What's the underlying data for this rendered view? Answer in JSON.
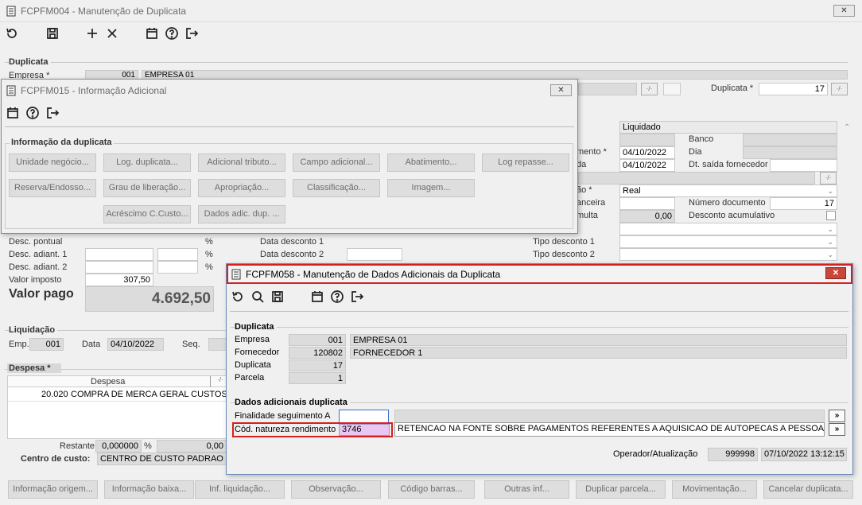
{
  "main": {
    "title": "FCPFM004 - Manutenção de Duplicata",
    "sections": {
      "duplicata": "Duplicata",
      "liquidacao": "Liquidação",
      "despesa": "Despesa *"
    },
    "labels": {
      "empresa": "Empresa *",
      "duplicata": "Duplicata *",
      "liquidado": "Liquidado",
      "banco": "Banco",
      "dia": "Dia",
      "dt_saida": "Dt. saída fornecedor",
      "mento": "mento *",
      "da": "da",
      "ao": "ão *",
      "anceira": "anceira",
      "numero_documento": "Número documento",
      "multa": "multa",
      "desconto_acumulativo": "Desconto acumulativo",
      "desc_pontual": "Desc. pontual",
      "desc_adiant1": "Desc. adiant. 1",
      "desc_adiant2": "Desc. adiant. 2",
      "valor_imposto": "Valor imposto",
      "valor_pago": "Valor pago",
      "data_desconto1": "Data desconto 1",
      "data_desconto2": "Data desconto 2",
      "tipo_desconto1": "Tipo desconto 1",
      "tipo_desconto2": "Tipo desconto 2",
      "emp": "Emp.",
      "data": "Data",
      "seq": "Seq.",
      "restante": "Restante",
      "centro_custo": "Centro de custo:",
      "pct": "%",
      "despesa_col": "Despesa"
    },
    "values": {
      "empresa_code": "001",
      "empresa_name": "EMPRESA 01",
      "duplicata": "17",
      "date1": "04/10/2022",
      "date2": "04/10/2022",
      "real": "Real",
      "numero_documento": "17",
      "multa": "0,00",
      "valor_imposto": "307,50",
      "valor_pago": "4.692,50",
      "emp": "001",
      "liq_data": "04/10/2022",
      "despesa_row": "20.020",
      "despesa_desc": "COMPRA DE MERCA GERAL CUSTOS M",
      "restante": "0,000000",
      "restante_pct": "0,00",
      "centro_custo": "CENTRO DE CUSTO PADRAO"
    },
    "buttons": [
      "Informação origem...",
      "Informação baixa...",
      "Inf. liquidação...",
      "Observação...",
      "Código barras...",
      "Outras inf...",
      "Duplicar parcela...",
      "Movimentação...",
      "Cancelar duplicata..."
    ]
  },
  "info": {
    "title": "FCPFM015 - Informação Adicional",
    "section": "Informação da duplicata",
    "buttons": [
      "Unidade negócio...",
      "Log. duplicata...",
      "Adicional tributo...",
      "Campo adicional...",
      "Abatimento...",
      "Log repasse...",
      "Reserva/Endosso...",
      "Grau de liberação...",
      "Apropriação...",
      "Classificação...",
      "Imagem...",
      "Acréscimo C.Custo...",
      "Dados adic. dup. ..."
    ]
  },
  "dados": {
    "title": "FCPFM058 - Manutenção de Dados Adicionais da Duplicata",
    "sections": {
      "duplicata": "Duplicata",
      "adicionais": "Dados adicionais duplicata"
    },
    "labels": {
      "empresa": "Empresa",
      "fornecedor": "Fornecedor",
      "duplicata": "Duplicata",
      "parcela": "Parcela",
      "finalidade": "Finalidade seguimento A",
      "cod_natureza": "Cód. natureza rendimento",
      "operador": "Operador/Atualização"
    },
    "values": {
      "empresa_code": "001",
      "empresa_name": "EMPRESA 01",
      "fornecedor_code": "120802",
      "fornecedor_name": "FORNECEDOR 1",
      "duplicata": "17",
      "parcela": "1",
      "finalidade": "",
      "cod_natureza": "3746",
      "natureza_desc": "RETENCAO NA FONTE SOBRE PAGAMENTOS REFERENTES A AQUISICAO DE AUTOPECAS A PESSOA JURIDICA",
      "operador": "999998",
      "atualizacao": "07/10/2022 13:12:15"
    },
    "arrow": "»"
  },
  "colors": {
    "highlight_red": "#d42020",
    "field_purple": "#e8c8f0",
    "close_red": "#c7473a"
  }
}
